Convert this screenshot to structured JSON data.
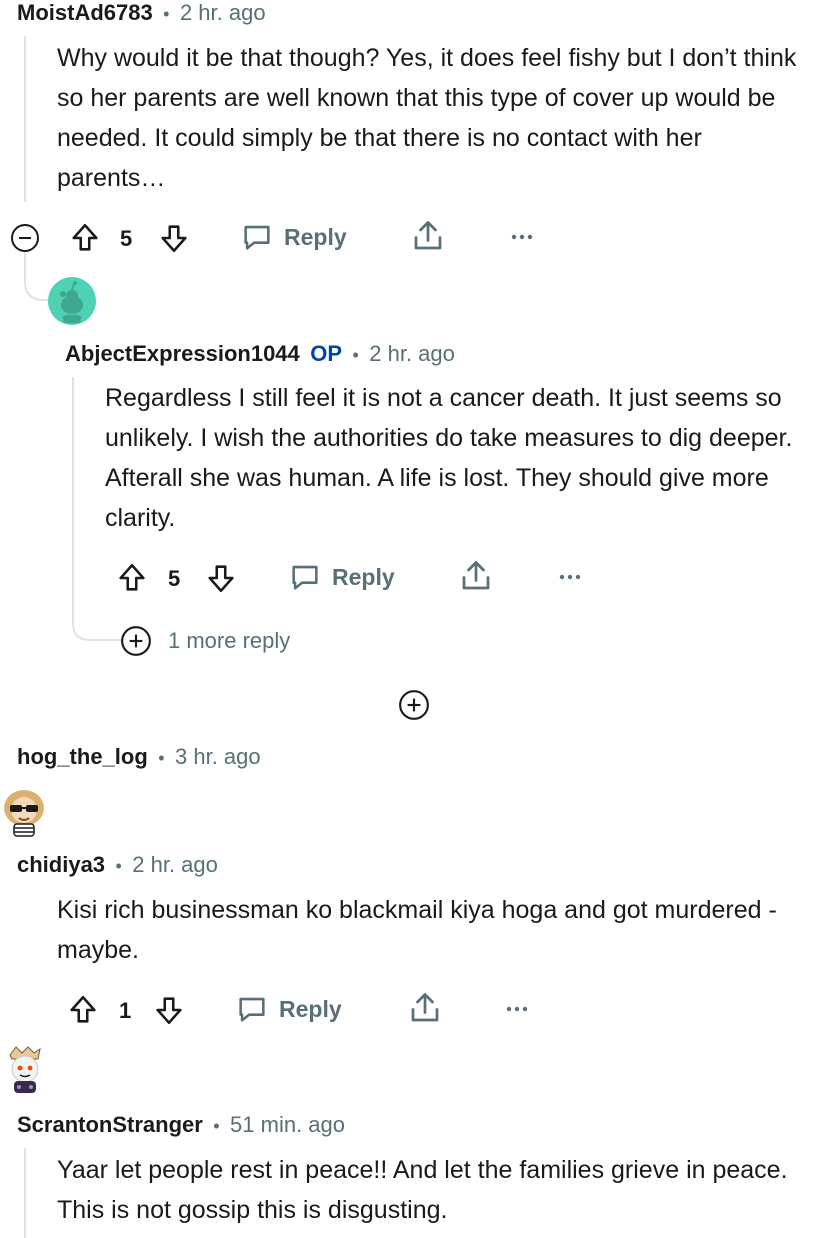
{
  "comments": [
    {
      "username": "MoistAd6783",
      "time": "2 hr. ago",
      "body": "Why would it be that though? Yes, it does feel fishy but I don’t think so her parents are well known that this type of cover up would be needed. It could simply be that there is no contact with her parents…",
      "votes": "5",
      "reply_label": "Reply"
    },
    {
      "username": "AbjectExpression1044",
      "op_badge": "OP",
      "time": "2 hr. ago",
      "body": "Regardless I still feel it is not a cancer death. It just seems so unlikely. I wish the authorities do take measures to dig deeper. Afterall she was human. A life is lost. They should give more clarity.",
      "votes": "5",
      "reply_label": "Reply",
      "more_replies": "1 more reply"
    },
    {
      "username": "hog_the_log",
      "time": "3 hr. ago"
    },
    {
      "username": "chidiya3",
      "time": "2 hr. ago",
      "body": "Kisi rich businessman ko blackmail kiya hoga and got murdered - maybe.",
      "votes": "1",
      "reply_label": "Reply"
    },
    {
      "username": "ScrantonStranger",
      "time": "51 min. ago",
      "body": "Yaar let people rest in peace!! And let the families grieve in peace. This is not gossip this is disgusting."
    }
  ],
  "separator": "•",
  "colors": {
    "text": "#1a1a1b",
    "meta": "#576f76",
    "op": "#0045ac",
    "thread": "#e0e3e5",
    "avatar_teal": "#4fd1b5"
  }
}
